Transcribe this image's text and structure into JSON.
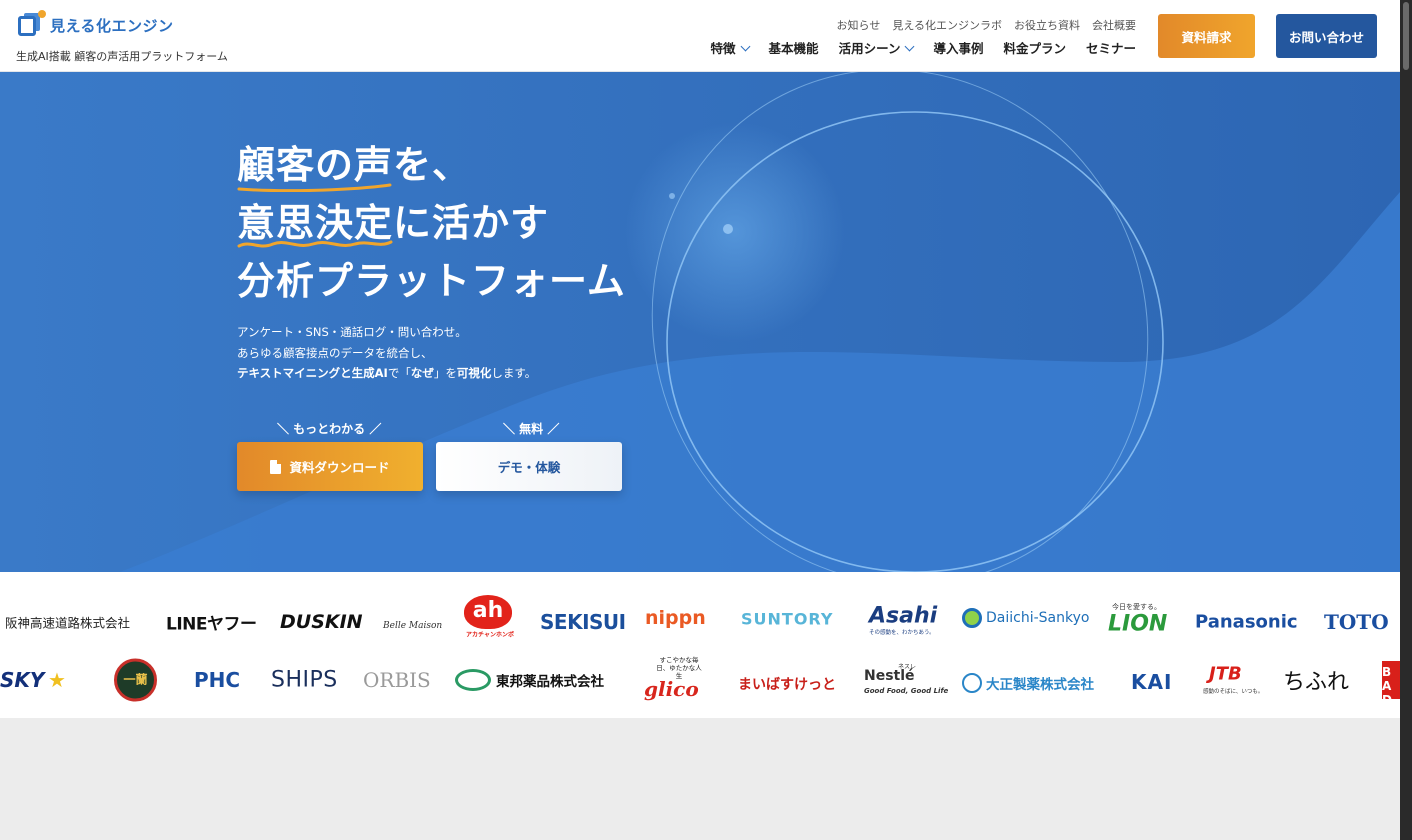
{
  "brand": {
    "name": "見える化エンジン",
    "tagline": "生成AI搭載 顧客の声活用プラットフォーム"
  },
  "subnav": [
    "お知らせ",
    "見える化エンジンラボ",
    "お役立ち資料",
    "会社概要"
  ],
  "mainnav": [
    {
      "label": "特徴",
      "dropdown": true
    },
    {
      "label": "基本機能",
      "dropdown": false
    },
    {
      "label": "活用シーン",
      "dropdown": true
    },
    {
      "label": "導入事例",
      "dropdown": false
    },
    {
      "label": "料金プラン",
      "dropdown": false
    },
    {
      "label": "セミナー",
      "dropdown": false
    }
  ],
  "header_buttons": {
    "request_docs": "資料請求",
    "contact": "お問い合わせ"
  },
  "hero": {
    "headline_1_highlight": "顧客の声",
    "headline_1_rest": "を、",
    "headline_2_highlight": "意思決定",
    "headline_2_rest": "に活かす",
    "headline_3": "分析プラットフォーム",
    "desc_1": "アンケート・SNS・通話ログ・問い合わせ。",
    "desc_2": "あらゆる顧客接点のデータを統合し、",
    "desc_3_bold": "テキストマイニングと生成AI",
    "desc_3_mid": "で「",
    "desc_3_bold2": "なぜ",
    "desc_3_mid2": "」を",
    "desc_3_bold3": "可視化",
    "desc_3_end": "します。",
    "cta1_caption": "＼ もっとわかる ／",
    "cta1_label": "資料ダウンロード",
    "cta2_caption": "＼ 無料 ／",
    "cta2_label": "デモ・体験"
  },
  "logos_row1": [
    "阪神高速道路株式会社",
    "LINEヤフー",
    "DUSKIN",
    "Belle Maison",
    "ah",
    "アカチャンホンポ",
    "SEKISUI",
    "nippn",
    "SUNTORY",
    "Asahi",
    "その感動を、わかちあう。",
    "Daiichi-Sankyo",
    "今日を愛する。",
    "LION",
    "Panasonic",
    "TOTO"
  ],
  "logos_row2": [
    "SKY",
    "一蘭",
    "PHC",
    "SHIPS",
    "ORBIS",
    "東邦薬品株式会社",
    "すこやかな毎日、ゆたかな人生",
    "glico",
    "まいばすけっと",
    "ネスレ",
    "Nestlé",
    "Good Food, Good Life",
    "大正製薬株式会社",
    "KAI",
    "JTB",
    "感動のそばに、いつも。",
    "ちふれ",
    "BA DA"
  ],
  "colors": {
    "brand_blue": "#2c6fc0",
    "navy": "#24579e",
    "orange": "#e2892a",
    "hero_blue": "#3374c4"
  }
}
